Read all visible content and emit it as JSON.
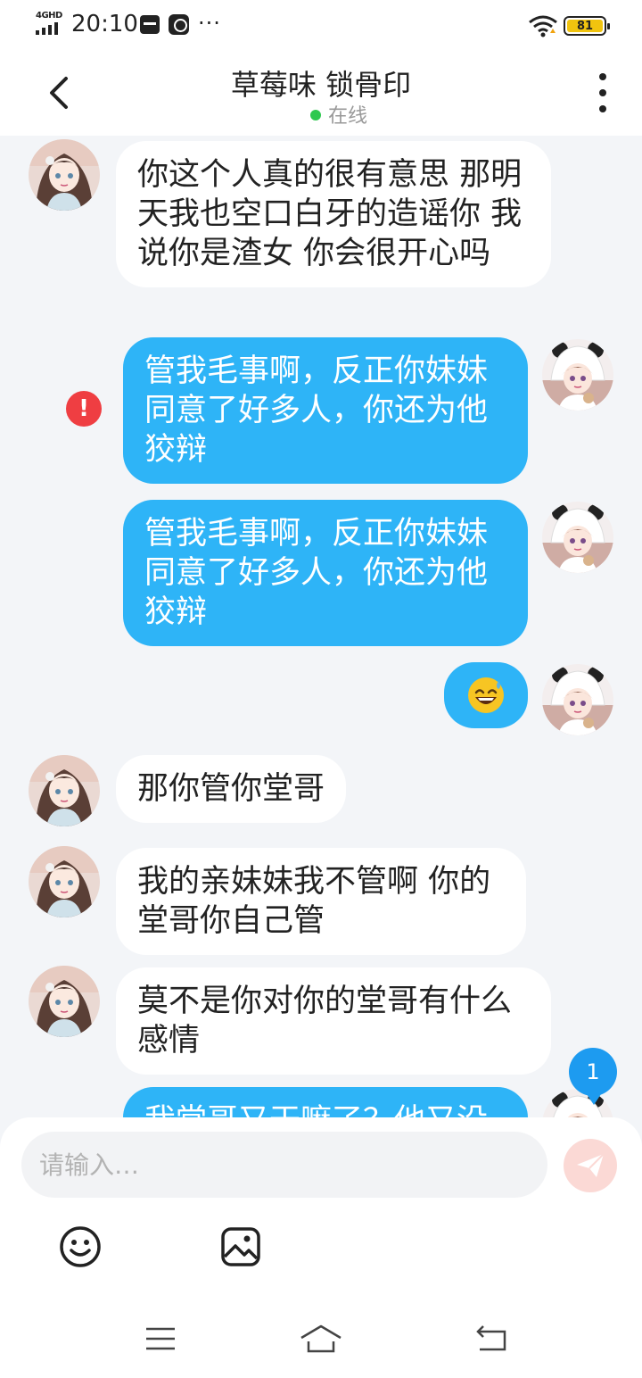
{
  "status_bar": {
    "network": "4GHD",
    "time": "20:10",
    "more": "···",
    "battery": "81"
  },
  "header": {
    "title": "草莓味 锁骨印",
    "status": "在线"
  },
  "messages": [
    {
      "side": "in",
      "text": "你这个人真的很有意思 那明天我也空口白牙的造谣你 我说你是渣女 你会很开心吗"
    },
    {
      "side": "out",
      "text": "管我毛事啊，反正你妹妹同意了好多人，你还为他狡辩",
      "failed": true
    },
    {
      "side": "out",
      "text": "管我毛事啊，反正你妹妹同意了好多人，你还为他狡辩"
    },
    {
      "side": "out",
      "text": "😅"
    },
    {
      "side": "in",
      "text": "那你管你堂哥"
    },
    {
      "side": "in",
      "text": "我的亲妹妹我不管啊 你的堂哥你自己管"
    },
    {
      "side": "in",
      "text": "莫不是你对你的堂哥有什么感情"
    },
    {
      "side": "out",
      "text": "我堂哥又干嘛了？他又没"
    }
  ],
  "unread_count": "1",
  "composer": {
    "placeholder": "请输入…",
    "icons": [
      "emoji-icon",
      "image-icon",
      "send-icon"
    ]
  },
  "nav": {
    "icons": [
      "menu-icon",
      "home-icon",
      "back-icon"
    ]
  },
  "colors": {
    "outgoing_bubble": "#2eb4f7",
    "incoming_bubble": "#ffffff",
    "background": "#f3f5f8",
    "online": "#2ec84f",
    "error": "#ef3e42",
    "badge": "#1d9bf0"
  }
}
